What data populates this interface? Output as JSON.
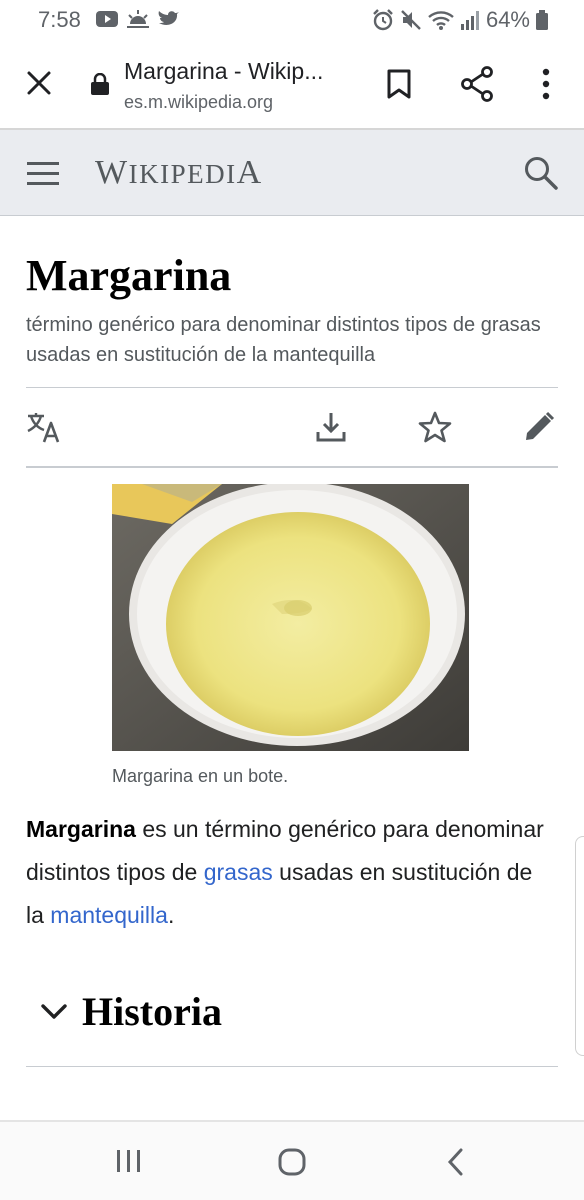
{
  "status_bar": {
    "time": "7:58",
    "battery": "64%",
    "left_icons": [
      "youtube-icon",
      "weather-icon",
      "twitter-icon"
    ],
    "right_icons": [
      "alarm-icon",
      "mute-icon",
      "wifi-icon",
      "signal-icon",
      "battery-icon"
    ]
  },
  "browser": {
    "page_title": "Margarina - Wikip...",
    "url": "es.m.wikipedia.org"
  },
  "wiki_header": {
    "logo_first": "W",
    "logo_mid": "IKIPEDI",
    "logo_last": "A"
  },
  "article": {
    "title": "Margarina",
    "description": "término genérico para denominar distintos tipos de grasas usadas en sustitución de la mantequilla",
    "image_caption": "Margarina en un bote.",
    "lead": {
      "bold": "Margarina",
      "text1": " es un término genérico para denominar distintos tipos de ",
      "link1": "grasas",
      "text2": " usadas en sustitución de la ",
      "link2": "mantequilla",
      "text3": "."
    },
    "section_heading": "Historia"
  },
  "colors": {
    "link": "#3366cc",
    "header_bg": "#eaecf0",
    "icon": "#54595d"
  }
}
